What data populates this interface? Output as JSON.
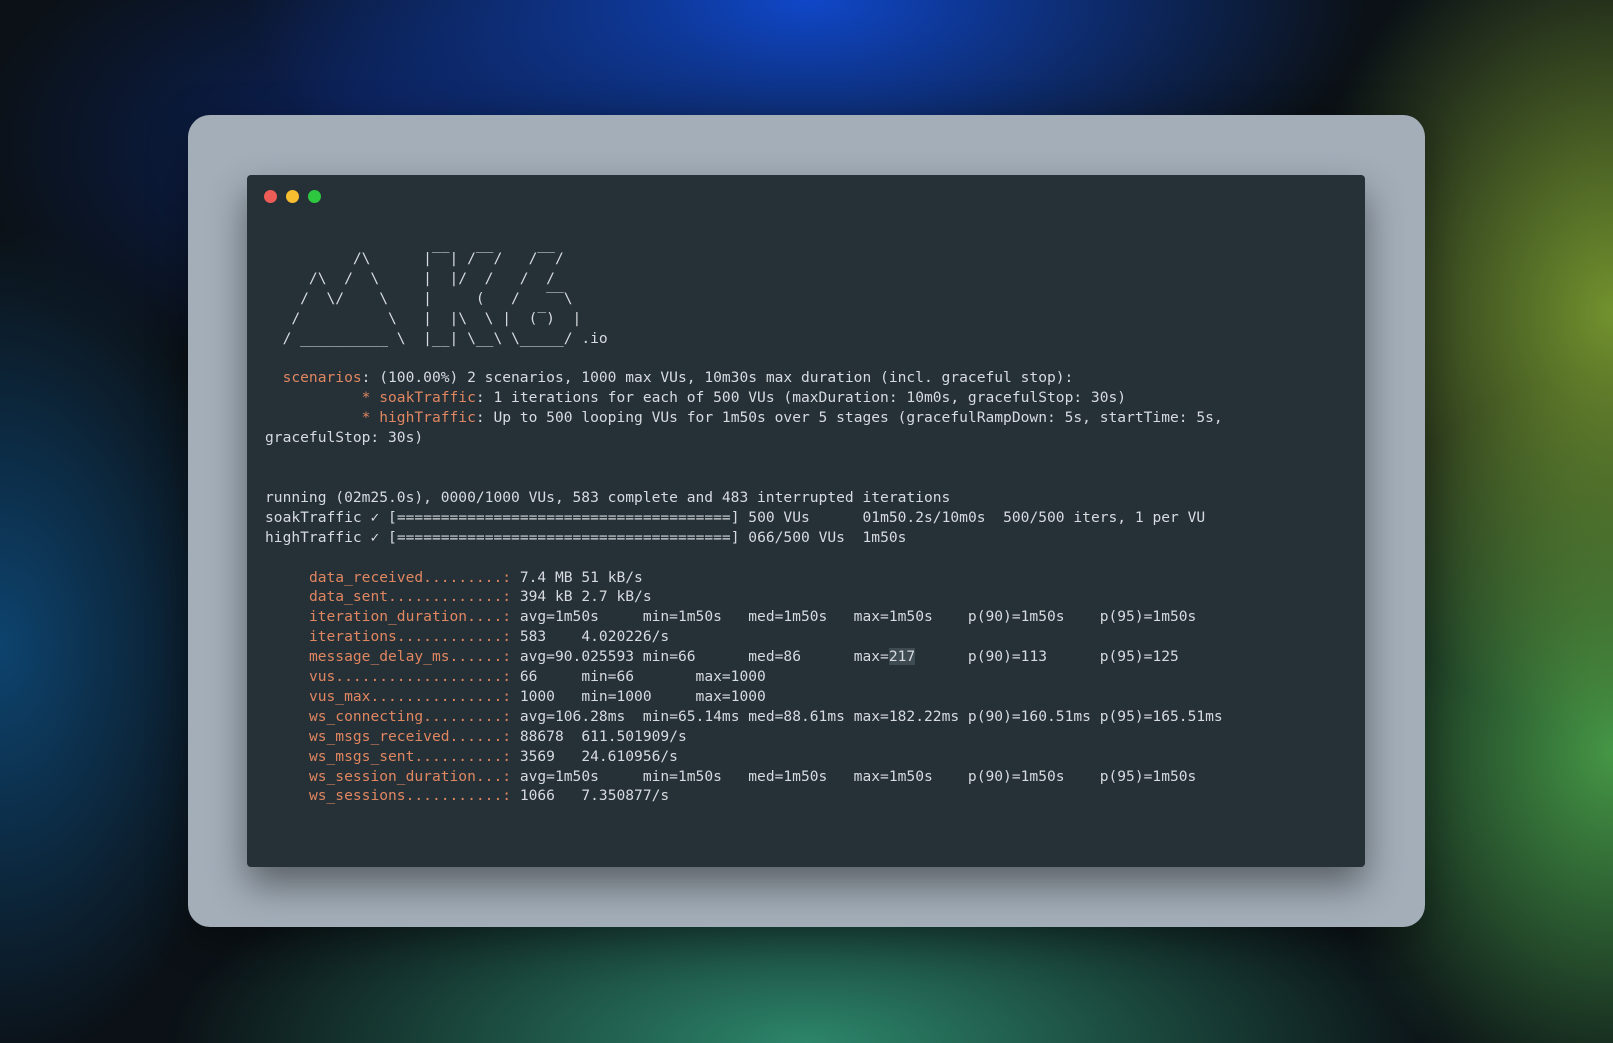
{
  "window_dots": [
    {
      "name": "close",
      "color": "#ed5c57"
    },
    {
      "name": "minimize",
      "color": "#f5bd2f"
    },
    {
      "name": "maximize",
      "color": "#2dc840"
    }
  ],
  "colors": {
    "foreground": "#d7dbdf",
    "accent_orange": "#e08660",
    "terminal_bg": "#253037",
    "frame_bg": "#a3aeb9"
  },
  "logo": {
    "lines": [
      "          /\\      |‾‾| /‾‾/   /‾‾/",
      "     /\\  /  \\     |  |/  /   /  /",
      "    /  \\/    \\    |     (   /   ‾‾\\",
      "   /          \\   |  |\\  \\ |  (‾)  |",
      "  / __________ \\  |__| \\__\\ \\_____/"
    ],
    "suffix": " .io"
  },
  "scenarios": {
    "label": "scenarios",
    "summary": ": (100.00%) 2 scenarios, 1000 max VUs, 10m30s max duration (incl. graceful stop):",
    "items": [
      {
        "name": "soakTraffic",
        "detail": ": 1 iterations for each of 500 VUs (maxDuration: 10m0s, gracefulStop: 30s)"
      },
      {
        "name": "highTraffic",
        "detail": ": Up to 500 looping VUs for 1m50s over 5 stages (gracefulRampDown: 5s, startTime: 5s,"
      }
    ],
    "wrap": "gracefulStop: 30s)"
  },
  "running": {
    "status": "running (02m25.0s), 0000/1000 VUs, 583 complete and 483 interrupted iterations",
    "rows": [
      {
        "name": "soakTraffic",
        "check": "✓",
        "bar": "[======================================]",
        "info": " 500 VUs      01m50.2s/10m0s  500/500 iters, 1 per VU"
      },
      {
        "name": "highTraffic",
        "check": "✓",
        "bar": "[======================================]",
        "info": " 066/500 VUs  1m50s"
      }
    ]
  },
  "metrics": [
    {
      "name": "data_received",
      "dots": ".........: ",
      "value": "7.4 MB 51 kB/s"
    },
    {
      "name": "data_sent",
      "dots": ".............: ",
      "value": "394 kB 2.7 kB/s"
    },
    {
      "name": "iteration_duration",
      "dots": "....: ",
      "value": "avg=1m50s     min=1m50s   med=1m50s   max=1m50s    p(90)=1m50s    p(95)=1m50s"
    },
    {
      "name": "iterations",
      "dots": "............: ",
      "value": "583    4.020226/s"
    },
    {
      "name": "message_delay_ms",
      "dots": "......: ",
      "value": "avg=90.025593 min=66      med=86      max=",
      "highlight": "217",
      "value_after": "      p(90)=113      p(95)=125"
    },
    {
      "name": "vus",
      "dots": "...................: ",
      "value": "66     min=66       max=1000"
    },
    {
      "name": "vus_max",
      "dots": "...............: ",
      "value": "1000   min=1000     max=1000"
    },
    {
      "name": "ws_connecting",
      "dots": ".........: ",
      "value": "avg=106.28ms  min=65.14ms med=88.61ms max=182.22ms p(90)=160.51ms p(95)=165.51ms"
    },
    {
      "name": "ws_msgs_received",
      "dots": "......: ",
      "value": "88678  611.501909/s"
    },
    {
      "name": "ws_msgs_sent",
      "dots": "..........: ",
      "value": "3569   24.610956/s"
    },
    {
      "name": "ws_session_duration",
      "dots": "...: ",
      "value": "avg=1m50s     min=1m50s   med=1m50s   max=1m50s    p(90)=1m50s    p(95)=1m50s"
    },
    {
      "name": "ws_sessions",
      "dots": "...........: ",
      "value": "1066   7.350877/s"
    }
  ]
}
